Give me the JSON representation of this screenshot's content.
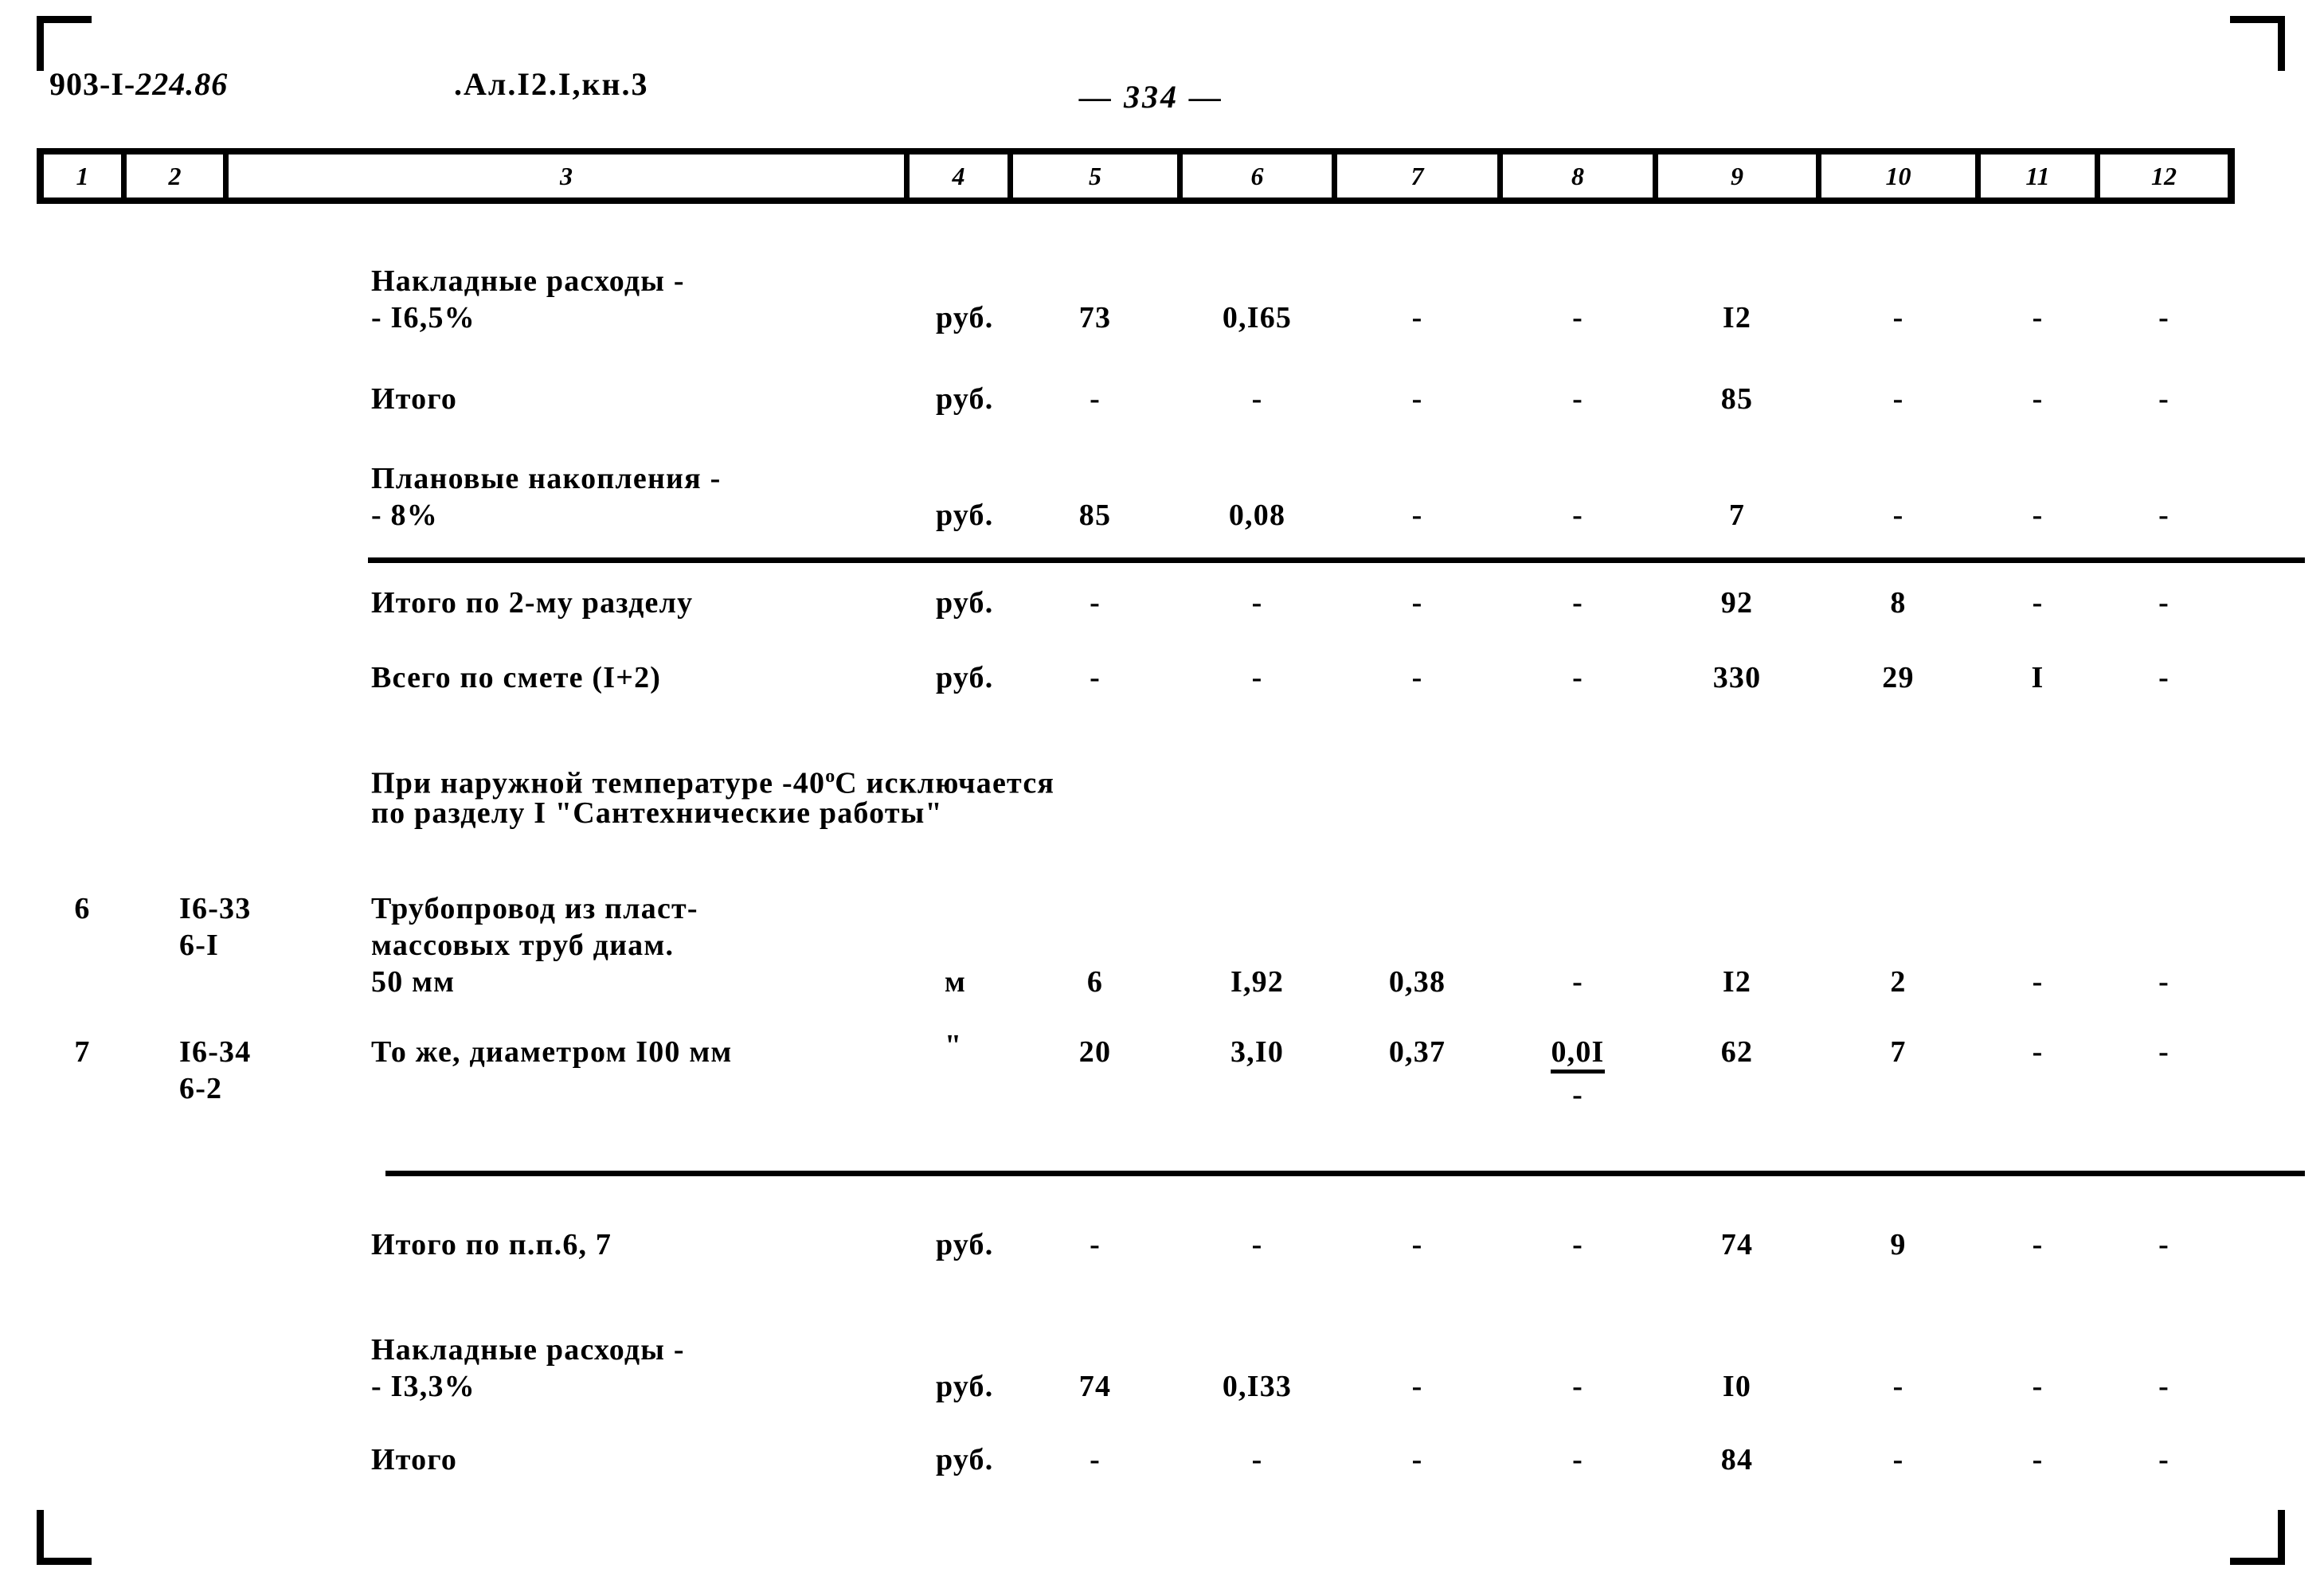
{
  "header": {
    "doc_code_prefix": "903-I-",
    "doc_code_hand": "224.86",
    "album": ".Ал.I2.I,кн.3",
    "page_number": "— 334 —"
  },
  "table": {
    "column_headers": [
      "1",
      "2",
      "3",
      "4",
      "5",
      "6",
      "7",
      "8",
      "9",
      "10",
      "11",
      "12"
    ],
    "rows": [
      {
        "c1": "",
        "c2": "",
        "c3_line1": "Накладные расходы -",
        "c3_line2": "- I6,5%",
        "c4": "руб.",
        "c5": "73",
        "c6": "0,I65",
        "c7": "-",
        "c8": "-",
        "c9": "I2",
        "c10": "-",
        "c11": "-",
        "c12": "-"
      },
      {
        "c1": "",
        "c2": "",
        "c3_line1": "Итого",
        "c3_line2": "",
        "c4": "руб.",
        "c5": "-",
        "c6": "-",
        "c7": "-",
        "c8": "-",
        "c9": "85",
        "c10": "-",
        "c11": "-",
        "c12": "-"
      },
      {
        "c1": "",
        "c2": "",
        "c3_line1": "Плановые накопления -",
        "c3_line2": "- 8%",
        "c4": "руб.",
        "c5": "85",
        "c6": "0,08",
        "c7": "-",
        "c8": "-",
        "c9": "7",
        "c10": "-",
        "c11": "-",
        "c12": "-"
      },
      {
        "c1": "",
        "c2": "",
        "c3_line1": "Итого по 2-му разделу",
        "c3_line2": "",
        "c4": "руб.",
        "c5": "-",
        "c6": "-",
        "c7": "-",
        "c8": "-",
        "c9": "92",
        "c10": "8",
        "c11": "-",
        "c12": "-"
      },
      {
        "c1": "",
        "c2": "",
        "c3_line1": "Всего по смете (I+2)",
        "c3_line2": "",
        "c4": "руб.",
        "c5": "-",
        "c6": "-",
        "c7": "-",
        "c8": "-",
        "c9": "330",
        "c10": "29",
        "c11": "I",
        "c12": "-"
      },
      {
        "c1": "6",
        "c2_line1": "I6-33",
        "c2_line2": "6-I",
        "c3_line1": "Трубопровод из пласт-",
        "c3_line2": "массовых труб диам.",
        "c3_line3": "50 мм",
        "c4": "м",
        "c5": "6",
        "c6": "I,92",
        "c7": "0,38",
        "c8": "-",
        "c9": "I2",
        "c10": "2",
        "c11": "-",
        "c12": "-"
      },
      {
        "c1": "7",
        "c2_line1": "I6-34",
        "c2_line2": "6-2",
        "c3_line1": "То же, диаметром I00 мм",
        "c3_line2": "",
        "c4": "\"",
        "c5": "20",
        "c6": "3,I0",
        "c7": "0,37",
        "c8": "0,0I",
        "c8_second": "-",
        "c9": "62",
        "c10": "7",
        "c11": "-",
        "c12": "-"
      },
      {
        "c1": "",
        "c2": "",
        "c3_line1": "Итого по п.п.6, 7",
        "c3_line2": "",
        "c4": "руб.",
        "c5": "-",
        "c6": "-",
        "c7": "-",
        "c8": "-",
        "c9": "74",
        "c10": "9",
        "c11": "-",
        "c12": "-"
      },
      {
        "c1": "",
        "c2": "",
        "c3_line1": "Накладные расходы -",
        "c3_line2": "- I3,3%",
        "c4": "руб.",
        "c5": "74",
        "c6": "0,I33",
        "c7": "-",
        "c8": "-",
        "c9": "I0",
        "c10": "-",
        "c11": "-",
        "c12": "-"
      },
      {
        "c1": "",
        "c2": "",
        "c3_line1": "Итого",
        "c3_line2": "",
        "c4": "руб.",
        "c5": "-",
        "c6": "-",
        "c7": "-",
        "c8": "-",
        "c9": "84",
        "c10": "-",
        "c11": "-",
        "c12": "-"
      }
    ],
    "note": {
      "line1_a": "При наружной температуре -40",
      "line1_sup": "o",
      "line1_b": "С исключается",
      "line2": "по разделу I \"Сантехнические работы\""
    }
  }
}
